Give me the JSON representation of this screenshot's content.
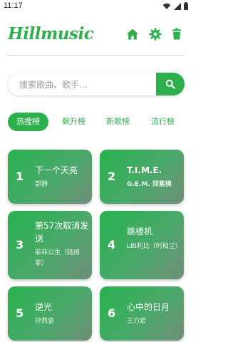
{
  "status": {
    "time": "11:17"
  },
  "app": {
    "logo_text": "Hillmusic"
  },
  "search": {
    "placeholder": "搜索歌曲、歌手..."
  },
  "tabs": [
    {
      "label": "热搜榜",
      "active": true
    },
    {
      "label": "飙升榜",
      "active": false
    },
    {
      "label": "新歌榜",
      "active": false
    },
    {
      "label": "流行榜",
      "active": false
    }
  ],
  "songs": [
    {
      "rank": "1",
      "title": "下一个天亮",
      "artist": "郭静"
    },
    {
      "rank": "2",
      "title": "T.I.M.E.",
      "artist": "G.E.M. 邓紫棋"
    },
    {
      "rank": "3",
      "title": "第57次取消发送",
      "artist": "菲菲公主（陆绮菲）"
    },
    {
      "rank": "4",
      "title": "跳楼机",
      "artist": "LBI利比（时柏尘）"
    },
    {
      "rank": "5",
      "title": "逆光",
      "artist": "孙燕姿"
    },
    {
      "rank": "6",
      "title": "心中的日月",
      "artist": "王力宏"
    }
  ],
  "colors": {
    "accent": "#2db04b"
  }
}
